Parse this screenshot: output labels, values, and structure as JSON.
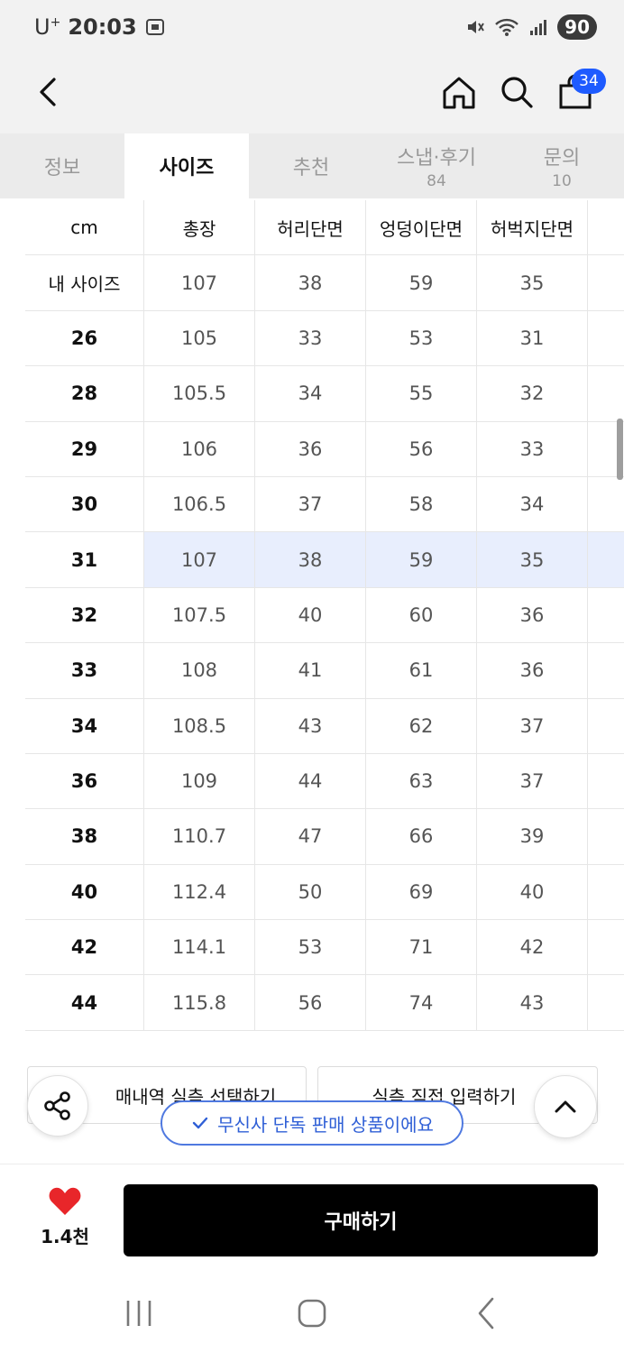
{
  "status_bar": {
    "carrier": "U",
    "carrier_sup": "+",
    "time": "20:03",
    "battery": "90"
  },
  "nav": {
    "cart_count": "34"
  },
  "tabs": [
    {
      "label": "정보",
      "count": ""
    },
    {
      "label": "사이즈",
      "count": ""
    },
    {
      "label": "추천",
      "count": ""
    },
    {
      "label": "스냅·후기",
      "count": "84"
    },
    {
      "label": "문의",
      "count": "10"
    }
  ],
  "table": {
    "headers": [
      "cm",
      "총장",
      "허리단면",
      "엉덩이단면",
      "허벅지단면"
    ],
    "rows": [
      [
        "내 사이즈",
        "107",
        "38",
        "59",
        "35"
      ],
      [
        "26",
        "105",
        "33",
        "53",
        "31"
      ],
      [
        "28",
        "105.5",
        "34",
        "55",
        "32"
      ],
      [
        "29",
        "106",
        "36",
        "56",
        "33"
      ],
      [
        "30",
        "106.5",
        "37",
        "58",
        "34"
      ],
      [
        "31",
        "107",
        "38",
        "59",
        "35"
      ],
      [
        "32",
        "107.5",
        "40",
        "60",
        "36"
      ],
      [
        "33",
        "108",
        "41",
        "61",
        "36"
      ],
      [
        "34",
        "108.5",
        "43",
        "62",
        "37"
      ],
      [
        "36",
        "109",
        "44",
        "63",
        "37"
      ],
      [
        "38",
        "110.7",
        "47",
        "66",
        "39"
      ],
      [
        "40",
        "112.4",
        "50",
        "69",
        "40"
      ],
      [
        "42",
        "114.1",
        "53",
        "71",
        "42"
      ],
      [
        "44",
        "115.8",
        "56",
        "74",
        "43"
      ]
    ]
  },
  "actions": {
    "purchase_history": "매내역 실측 선택하기",
    "direct_input": "실측 직접 입력하기",
    "exclusive": "무신사 단독 판매 상품이에요"
  },
  "bottom": {
    "like_count": "1.4천",
    "buy_label": "구매하기"
  },
  "colors": {
    "accent": "#1e5bff",
    "highlight": "#e8eefd",
    "heart": "#e8262a"
  }
}
